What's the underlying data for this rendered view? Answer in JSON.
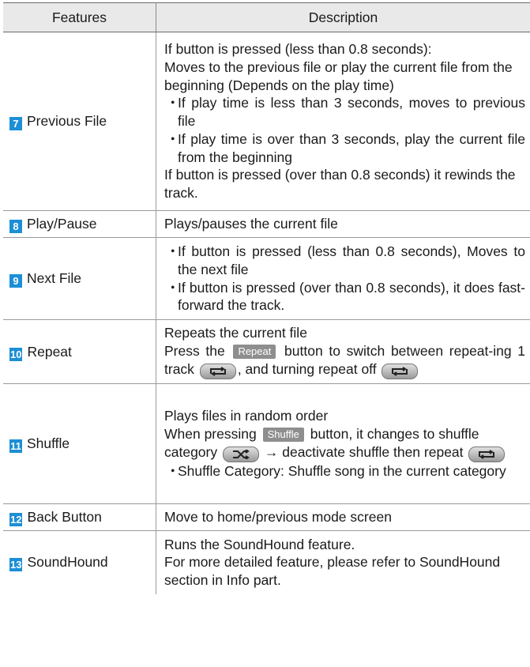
{
  "header": {
    "col1": "Features",
    "col2": "Description"
  },
  "rows": [
    {
      "num": "7",
      "feature": "Previous File",
      "lines": [
        "If button is pressed (less than 0.8 seconds):",
        "Moves to the previous file or play the current file from the beginning (Depends on the play time)"
      ],
      "bullets": [
        "If play time is less than 3 seconds, moves to previous file",
        "If play time is over than 3 seconds, play the current file from the beginning"
      ],
      "after": "If button is pressed (over than 0.8 seconds) it rewinds the track."
    },
    {
      "num": "8",
      "feature": "Play/Pause",
      "text": "Plays/pauses the current file"
    },
    {
      "num": "9",
      "feature": "Next File",
      "bullets": [
        "If button is pressed (less than 0.8 seconds), Moves to the next file",
        "If button is pressed (over than 0.8 seconds), it does fast-forward the track."
      ]
    },
    {
      "num": "10",
      "feature": "Repeat",
      "line1": "Repeats the current file",
      "press": "Press the",
      "button_label": "Repeat",
      "rest": "button to switch between repeat-ing 1 track",
      "mid": ", and turning repeat off",
      "icon_repeat_one": "repeat-one-icon",
      "icon_repeat_off": "repeat-off-icon"
    },
    {
      "num": "11",
      "feature": "Shuffle",
      "line1": "Plays files in random order",
      "when": "When pressing",
      "button_label": "Shuffle",
      "rest": "button, it changes to shuffle category",
      "arrow_text": "→ deactivate shuffle then repeat",
      "icon_shuffle": "shuffle-icon",
      "icon_repeat": "repeat-icon",
      "bullet": "Shuffle Category: Shuffle song in the current category"
    },
    {
      "num": "12",
      "feature": "Back Button",
      "text": "Move to home/previous mode screen"
    },
    {
      "num": "13",
      "feature": "SoundHound",
      "lines": [
        "Runs the SoundHound feature.",
        "For more detailed feature, please refer to SoundHound section in Info part."
      ]
    }
  ],
  "colors": {
    "number_badge": "#1c8fd6",
    "header_bg": "#e9e9e9",
    "button_label_bg": "#8e8e8e"
  }
}
